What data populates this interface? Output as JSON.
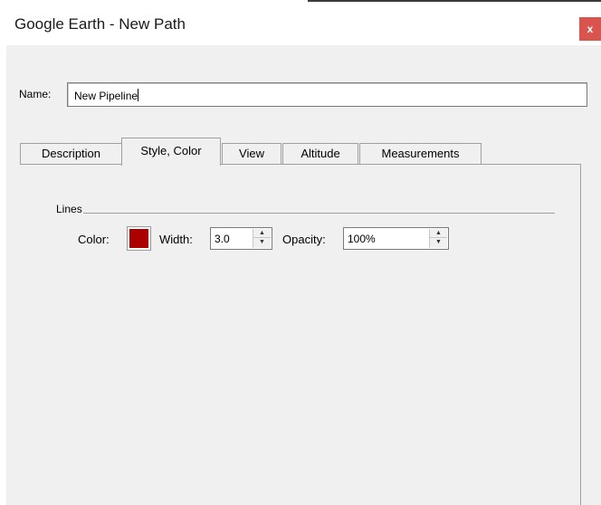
{
  "window": {
    "title": "Google Earth - New Path",
    "close_label": "x"
  },
  "name_field": {
    "label": "Name:",
    "value": "New Pipeline"
  },
  "tabs": [
    {
      "label": "Description",
      "active": false
    },
    {
      "label": "Style, Color",
      "active": true
    },
    {
      "label": "View",
      "active": false
    },
    {
      "label": "Altitude",
      "active": false
    },
    {
      "label": "Measurements",
      "active": false
    }
  ],
  "lines_group": {
    "label": "Lines",
    "color_label": "Color:",
    "color_value": "#aa0000",
    "width_label": "Width:",
    "width_value": "3.0",
    "opacity_label": "Opacity:",
    "opacity_value": "100%"
  },
  "colors": {
    "close_button": "#d9534f",
    "dialog_background": "#f0f0f0",
    "line_color": "#aa0000"
  }
}
